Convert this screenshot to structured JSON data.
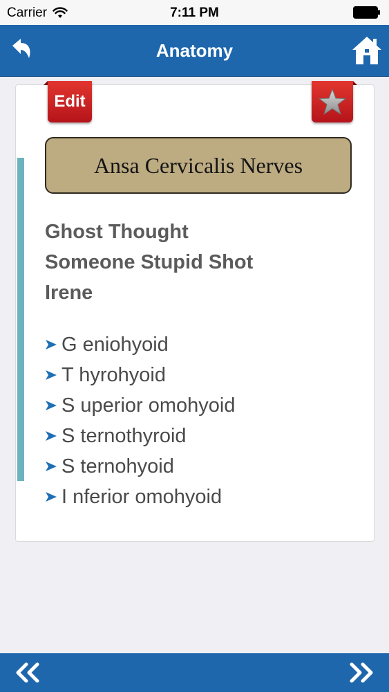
{
  "status_bar": {
    "carrier": "Carrier",
    "time": "7:11 PM",
    "icons": [
      "wifi-icon",
      "battery-icon"
    ]
  },
  "nav": {
    "title": "Anatomy",
    "back_icon": "back-arrow-icon",
    "home_icon": "home-icon",
    "color": "#1e67ad"
  },
  "card": {
    "edit_label": "Edit",
    "favorite_icon": "star-icon",
    "title": "Ansa Cervicalis Nerves",
    "title_bg": "#bdab82",
    "accent_color": "#6db3bd",
    "mnemonic_lines": [
      "Ghost Thought",
      "Someone Stupid Shot",
      "Irene"
    ],
    "items": [
      "G eniohyoid",
      "T hyrohyoid",
      "S uperior omohyoid",
      "S ternothyroid",
      "S ternohyoid",
      "I nferior omohyoid"
    ],
    "bullet_icon": "arrow-bullet-icon"
  },
  "bottom_bar": {
    "prev_icon": "double-chevron-left-icon",
    "next_icon": "double-chevron-right-icon"
  }
}
